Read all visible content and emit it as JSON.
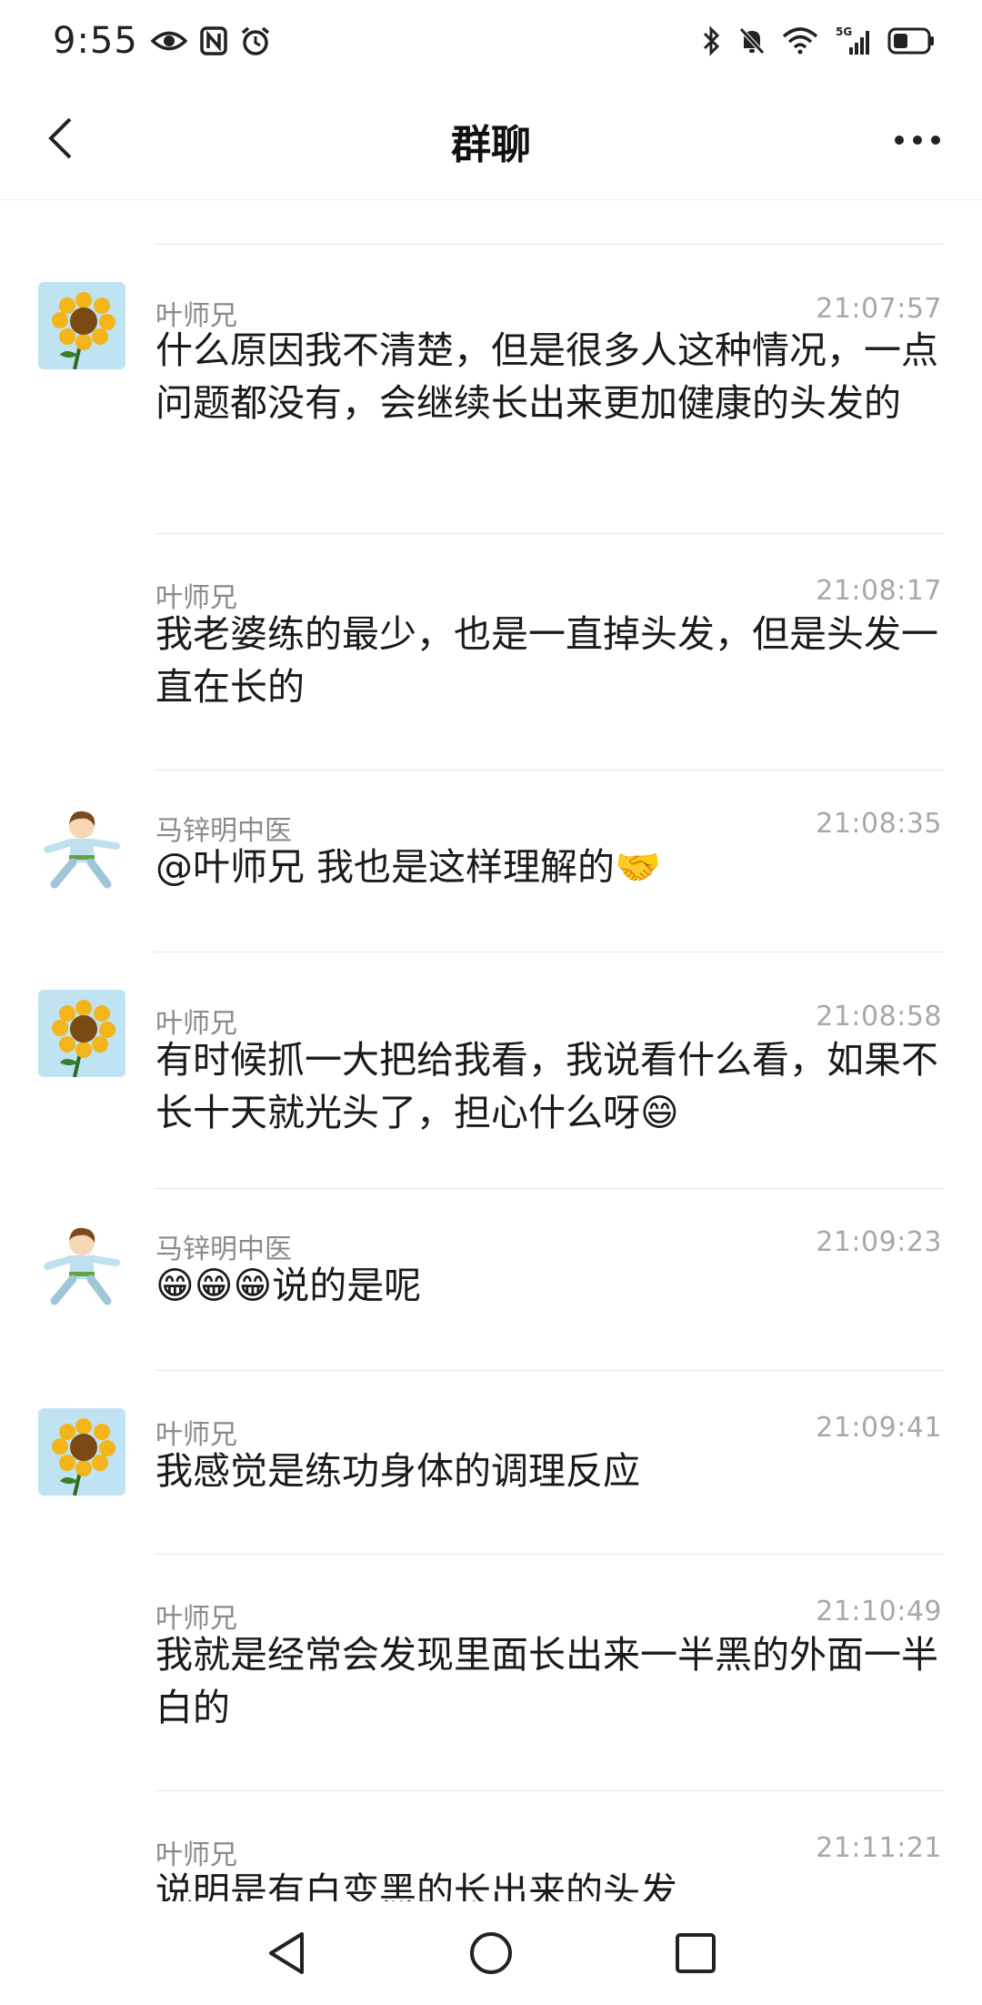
{
  "status_bar": {
    "time": "9:55",
    "left_icons": [
      "eye-icon",
      "nfc-icon",
      "alarm-icon"
    ],
    "right_icons": [
      "bluetooth-icon",
      "mute-icon",
      "wifi-icon",
      "signal-5g-icon",
      "battery-icon"
    ],
    "network_label": "5G"
  },
  "header": {
    "title": "群聊"
  },
  "messages": [
    {
      "sender": "叶师兄",
      "time": "21:07:57",
      "text": "什么原因我不清楚，但是很多人这种情况，一点问题都没有，会继续长出来更加健康的头发的",
      "avatar": "sunflower"
    },
    {
      "sender": "叶师兄",
      "time": "21:08:17",
      "text": "我老婆练的最少，也是一直掉头发，但是头发一直在长的",
      "avatar": ""
    },
    {
      "sender": "马锌明中医",
      "time": "21:08:35",
      "text": "@叶师兄 我也是这样理解的🤝",
      "avatar": "kungfu-boy"
    },
    {
      "sender": "叶师兄",
      "time": "21:08:58",
      "text": "有时候抓一大把给我看，我说看什么看，如果不长十天就光头了，担心什么呀😄",
      "avatar": "sunflower"
    },
    {
      "sender": "马锌明中医",
      "time": "21:09:23",
      "text": "😁😁😁说的是呢",
      "avatar": "kungfu-boy"
    },
    {
      "sender": "叶师兄",
      "time": "21:09:41",
      "text": "我感觉是练功身体的调理反应",
      "avatar": "sunflower"
    },
    {
      "sender": "叶师兄",
      "time": "21:10:49",
      "text": "我就是经常会发现里面长出来一半黑的外面一半白的",
      "avatar": ""
    },
    {
      "sender": "叶师兄",
      "time": "21:11:21",
      "text": "说明是有白变黑的长出来的头发",
      "avatar": ""
    }
  ],
  "nav_bar": {
    "icons": [
      "back-triangle-icon",
      "home-circle-icon",
      "recents-square-icon"
    ]
  }
}
